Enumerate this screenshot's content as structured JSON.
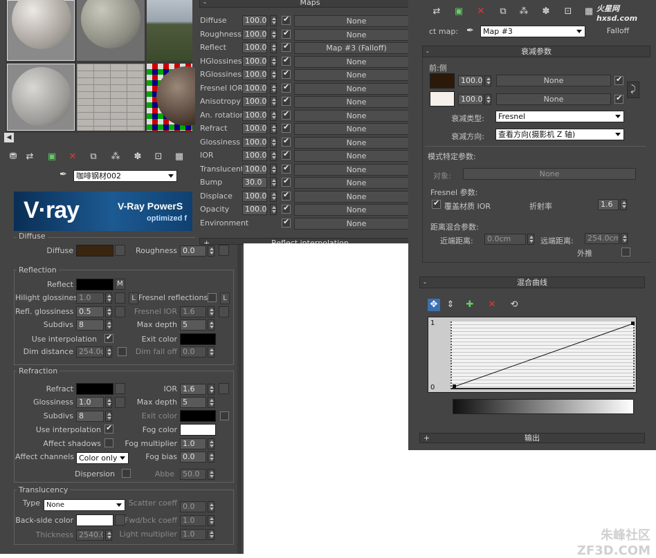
{
  "brand": {
    "logo_text": "V·ray",
    "banner_title": "V-Ray PowerS",
    "banner_sub": "optimized f"
  },
  "watermarks": {
    "top": "火星网 hxsd.com",
    "bottom": "朱峰社区 ZF3D.COM"
  },
  "left": {
    "material_name": "咖啡钢材002",
    "diffuse": {
      "title": "Diffuse",
      "diffuse_label": "Diffuse",
      "roughness_label": "Roughness",
      "roughness": "0.0"
    },
    "reflection": {
      "title": "Reflection",
      "reflect_label": "Reflect",
      "m_badge": "M",
      "hilight_label": "Hilight glossiness",
      "hilight": "1.0",
      "l_btn": "L",
      "fresnel_label": "Fresnel reflections",
      "fresnel_l": "L",
      "refl_gloss_label": "Refl. glossiness",
      "refl_gloss": "0.5",
      "fresnel_ior_label": "Fresnel IOR",
      "fresnel_ior": "1.6",
      "subdivs_label": "Subdivs",
      "subdivs": "8",
      "maxdepth_label": "Max depth",
      "maxdepth": "5",
      "interp_label": "Use interpolation",
      "exit_label": "Exit color",
      "dimdist_label": "Dim distance",
      "dimdist": "254.0c",
      "dimfall_label": "Dim fall off",
      "dimfall": "0.0"
    },
    "refraction": {
      "title": "Refraction",
      "refract_label": "Refract",
      "ior_label": "IOR",
      "ior": "1.6",
      "gloss_label": "Glossiness",
      "gloss": "1.0",
      "maxdepth_label": "Max depth",
      "maxdepth": "5",
      "subdivs_label": "Subdivs",
      "subdivs": "8",
      "exit_label": "Exit color",
      "interp_label": "Use interpolation",
      "fog_label": "Fog color",
      "shadows_label": "Affect shadows",
      "fogmult_label": "Fog multiplier",
      "fogmult": "1.0",
      "channels_label": "Affect channels",
      "channels": "Color only",
      "fogbias_label": "Fog bias",
      "fogbias": "0.0",
      "dispersion_label": "Dispersion",
      "abbe_label": "Abbe",
      "abbe": "50.0"
    },
    "translucency": {
      "title": "Translucency",
      "type_label": "Type",
      "type": "None",
      "scatter_label": "Scatter coeff",
      "scatter": "0.0",
      "backside_label": "Back-side color",
      "fwdbck_label": "Fwd/bck coeff",
      "fwdbck": "1.0",
      "thickness_label": "Thickness",
      "thickness": "2540.0",
      "light_label": "Light multiplier",
      "light": "1.0"
    }
  },
  "maps": {
    "title": "Maps",
    "footer": "Reflect interpolation",
    "rows": [
      {
        "label": "Diffuse",
        "value": "100.0",
        "map": "None"
      },
      {
        "label": "Roughness",
        "value": "100.0",
        "map": "None"
      },
      {
        "label": "Reflect",
        "value": "100.0",
        "map": "Map #3  (Falloff)"
      },
      {
        "label": "HGlossiness",
        "value": "100.0",
        "map": "None"
      },
      {
        "label": "RGlossiness",
        "value": "100.0",
        "map": "None"
      },
      {
        "label": "Fresnel IOR",
        "value": "100.0",
        "map": "None"
      },
      {
        "label": "Anisotropy",
        "value": "100.0",
        "map": "None"
      },
      {
        "label": "An. rotation",
        "value": "100.0",
        "map": "None"
      },
      {
        "label": "Refract",
        "value": "100.0",
        "map": "None"
      },
      {
        "label": "Glossiness",
        "value": "100.0",
        "map": "None"
      },
      {
        "label": "IOR",
        "value": "100.0",
        "map": "None"
      },
      {
        "label": "Translucent",
        "value": "100.0",
        "map": "None"
      },
      {
        "label": "Bump",
        "value": "30.0",
        "map": "None"
      },
      {
        "label": "Displace",
        "value": "100.0",
        "map": "None"
      },
      {
        "label": "Opacity",
        "value": "100.0",
        "map": "None"
      },
      {
        "label": "Environment",
        "value": "",
        "map": "None"
      }
    ]
  },
  "falloff": {
    "map_label": "ct map:",
    "map_name": "Map #3",
    "type_btn": "Falloff",
    "params_title": "衰减参数",
    "front_side": "前:侧",
    "front_val": "100.0",
    "front_map": "None",
    "side_val": "100.0",
    "side_map": "None",
    "type_label": "衰减类型:",
    "type_value": "Fresnel",
    "dir_label": "衰减方向:",
    "dir_value": "查看方向(摄影机 Z 轴)",
    "mode_title": "模式特定参数:",
    "object_label": "对象:",
    "object_value": "None",
    "fresnel_title": "Fresnel 参数:",
    "override_label": "覆盖材质 IOR",
    "ior_label": "折射率",
    "ior": "1.6",
    "dist_title": "距离混合参数:",
    "near_label": "近端距离:",
    "near": "0.0cm",
    "far_label": "远端距离:",
    "far": "254.0cm",
    "extrap_label": "外推",
    "curve_title": "混合曲线",
    "curve_top": "1",
    "curve_bottom": "0",
    "output_title": "输出"
  },
  "colors": {
    "diffuse": "#3a2510",
    "reflect": "#000000",
    "front": "#2b1a0a",
    "side": "#f5f0ea"
  }
}
